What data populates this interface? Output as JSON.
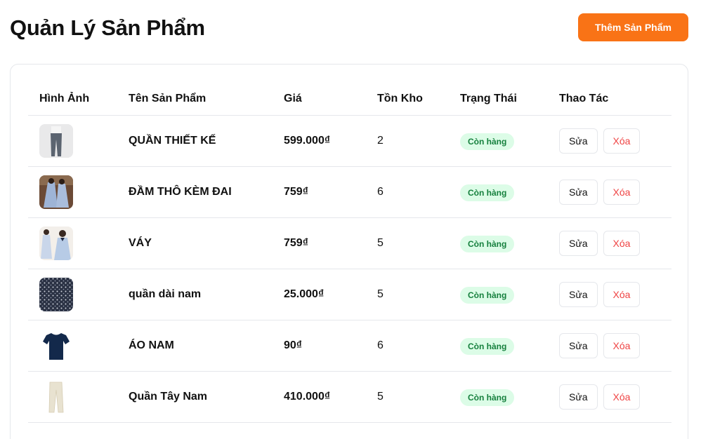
{
  "header": {
    "title": "Quản Lý Sản Phẩm",
    "add_button": "Thêm Sản Phẩm"
  },
  "table": {
    "columns": [
      "Hình Ảnh",
      "Tên Sản Phẩm",
      "Giá",
      "Tồn Kho",
      "Trạng Thái",
      "Thao Tác"
    ],
    "rows": [
      {
        "thumb_icon": "pants-grey-photo",
        "name": "QUẦN THIẾT KẾ",
        "price": "599.000₫",
        "stock": "2",
        "status": "Còn hàng",
        "edit": "Sửa",
        "delete": "Xóa"
      },
      {
        "thumb_icon": "dress-blue-floral-photo",
        "name": "ĐẦM THÔ KÈM ĐAI",
        "price": "759₫",
        "stock": "6",
        "status": "Còn hàng",
        "edit": "Sửa",
        "delete": "Xóa"
      },
      {
        "thumb_icon": "dress-light-blue-photo",
        "name": "VÁY",
        "price": "759₫",
        "stock": "5",
        "status": "Còn hàng",
        "edit": "Sửa",
        "delete": "Xóa"
      },
      {
        "thumb_icon": "fabric-pattern-photo",
        "name": "quần dài nam",
        "price": "25.000₫",
        "stock": "5",
        "status": "Còn hàng",
        "edit": "Sửa",
        "delete": "Xóa"
      },
      {
        "thumb_icon": "tshirt-navy-photo",
        "name": "ÁO NAM",
        "price": "90₫",
        "stock": "6",
        "status": "Còn hàng",
        "edit": "Sửa",
        "delete": "Xóa"
      },
      {
        "thumb_icon": "trousers-beige-photo",
        "name": "Quần Tây Nam",
        "price": "410.000₫",
        "stock": "5",
        "status": "Còn hàng",
        "edit": "Sửa",
        "delete": "Xóa"
      }
    ]
  },
  "colors": {
    "accent": "#f97316",
    "badge_bg": "#dcfce7",
    "badge_text": "#15803d",
    "delete_text": "#ef4444",
    "border": "#e5e7eb"
  }
}
